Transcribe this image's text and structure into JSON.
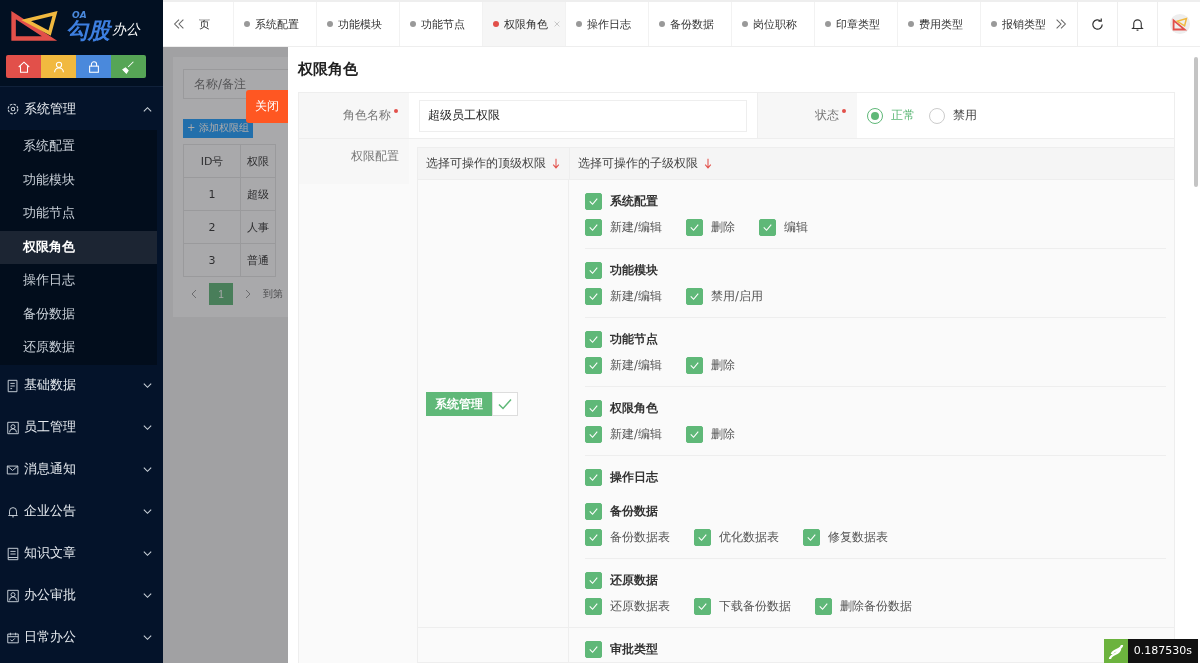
{
  "sidebar": {
    "logo": {
      "tag": "OA",
      "name": "勾股",
      "suffix": "办公"
    },
    "quick_buttons": [
      {
        "kind": "home",
        "color": "#e2504a"
      },
      {
        "kind": "user",
        "color": "#f1b93f"
      },
      {
        "kind": "lock",
        "color": "#4a89dc"
      },
      {
        "kind": "brush",
        "color": "#56a556"
      }
    ],
    "menu": [
      {
        "label": "系统管理",
        "kind": "gear",
        "expanded": true,
        "children": [
          {
            "label": "系统配置",
            "selected": false
          },
          {
            "label": "功能模块",
            "selected": false
          },
          {
            "label": "功能节点",
            "selected": false
          },
          {
            "label": "权限角色",
            "selected": true
          },
          {
            "label": "操作日志",
            "selected": false
          },
          {
            "label": "备份数据",
            "selected": false
          },
          {
            "label": "还原数据",
            "selected": false
          }
        ]
      },
      {
        "label": "基础数据",
        "kind": "list",
        "expanded": false
      },
      {
        "label": "员工管理",
        "kind": "person",
        "expanded": false
      },
      {
        "label": "消息通知",
        "kind": "mail",
        "expanded": false
      },
      {
        "label": "企业公告",
        "kind": "bell",
        "expanded": false
      },
      {
        "label": "知识文章",
        "kind": "book",
        "expanded": false
      },
      {
        "label": "办公审批",
        "kind": "person",
        "expanded": false
      },
      {
        "label": "日常办公",
        "kind": "calendar",
        "expanded": false
      }
    ]
  },
  "tabs": [
    {
      "label": "页",
      "selected": false,
      "clipped": true
    },
    {
      "label": "系统配置",
      "selected": false
    },
    {
      "label": "功能模块",
      "selected": false
    },
    {
      "label": "功能节点",
      "selected": false
    },
    {
      "label": "权限角色",
      "selected": true
    },
    {
      "label": "操作日志",
      "selected": false
    },
    {
      "label": "备份数据",
      "selected": false
    },
    {
      "label": "岗位职称",
      "selected": false
    },
    {
      "label": "印章类型",
      "selected": false
    },
    {
      "label": "费用类型",
      "selected": false
    },
    {
      "label": "报销类型",
      "selected": false
    }
  ],
  "background_page": {
    "search": {
      "placeholder": "名称/备注"
    },
    "add_button": "+ 添加权限组",
    "table": {
      "columns": [
        "ID号",
        "权限"
      ],
      "rows": [
        [
          "1",
          "超级"
        ],
        [
          "2",
          "人事"
        ],
        [
          "3",
          "普通"
        ]
      ]
    },
    "pagination": {
      "page": "1",
      "goto": "到第"
    }
  },
  "drawer": {
    "close_button": "关闭",
    "title": "权限角色",
    "name_field": {
      "label": "角色名称",
      "required": true,
      "value": "超级员工权限"
    },
    "status_field": {
      "label": "状态",
      "required": true,
      "options": [
        {
          "label": "正常",
          "selected": true
        },
        {
          "label": "禁用",
          "selected": false
        }
      ]
    },
    "permissions": {
      "label": "权限配置",
      "headers": [
        "选择可操作的顶级权限",
        "选择可操作的子级权限"
      ],
      "groups": [
        {
          "label": "系统管理",
          "checked": true,
          "items": [
            {
              "label": "系统配置",
              "checked": true,
              "actions": [
                {
                  "label": "新建/编辑",
                  "checked": true
                },
                {
                  "label": "删除",
                  "checked": true
                },
                {
                  "label": "编辑",
                  "checked": true
                }
              ]
            },
            {
              "label": "功能模块",
              "checked": true,
              "actions": [
                {
                  "label": "新建/编辑",
                  "checked": true
                },
                {
                  "label": "禁用/启用",
                  "checked": true
                }
              ]
            },
            {
              "label": "功能节点",
              "checked": true,
              "actions": [
                {
                  "label": "新建/编辑",
                  "checked": true
                },
                {
                  "label": "删除",
                  "checked": true
                }
              ]
            },
            {
              "label": "权限角色",
              "checked": true,
              "actions": [
                {
                  "label": "新建/编辑",
                  "checked": true
                },
                {
                  "label": "删除",
                  "checked": true
                }
              ]
            },
            {
              "label": "操作日志",
              "checked": true
            },
            {
              "label": "备份数据",
              "checked": true,
              "actions": [
                {
                  "label": "备份数据表",
                  "checked": true
                },
                {
                  "label": "优化数据表",
                  "checked": true
                },
                {
                  "label": "修复数据表",
                  "checked": true
                }
              ]
            },
            {
              "label": "还原数据",
              "checked": true,
              "actions": [
                {
                  "label": "还原数据表",
                  "checked": true
                },
                {
                  "label": "下载备份数据",
                  "checked": true
                },
                {
                  "label": "删除备份数据",
                  "checked": true
                }
              ]
            }
          ]
        },
        {
          "items": [
            {
              "label": "审批类型",
              "checked": true
            }
          ]
        }
      ]
    }
  },
  "debug_badge": "0.187530s"
}
